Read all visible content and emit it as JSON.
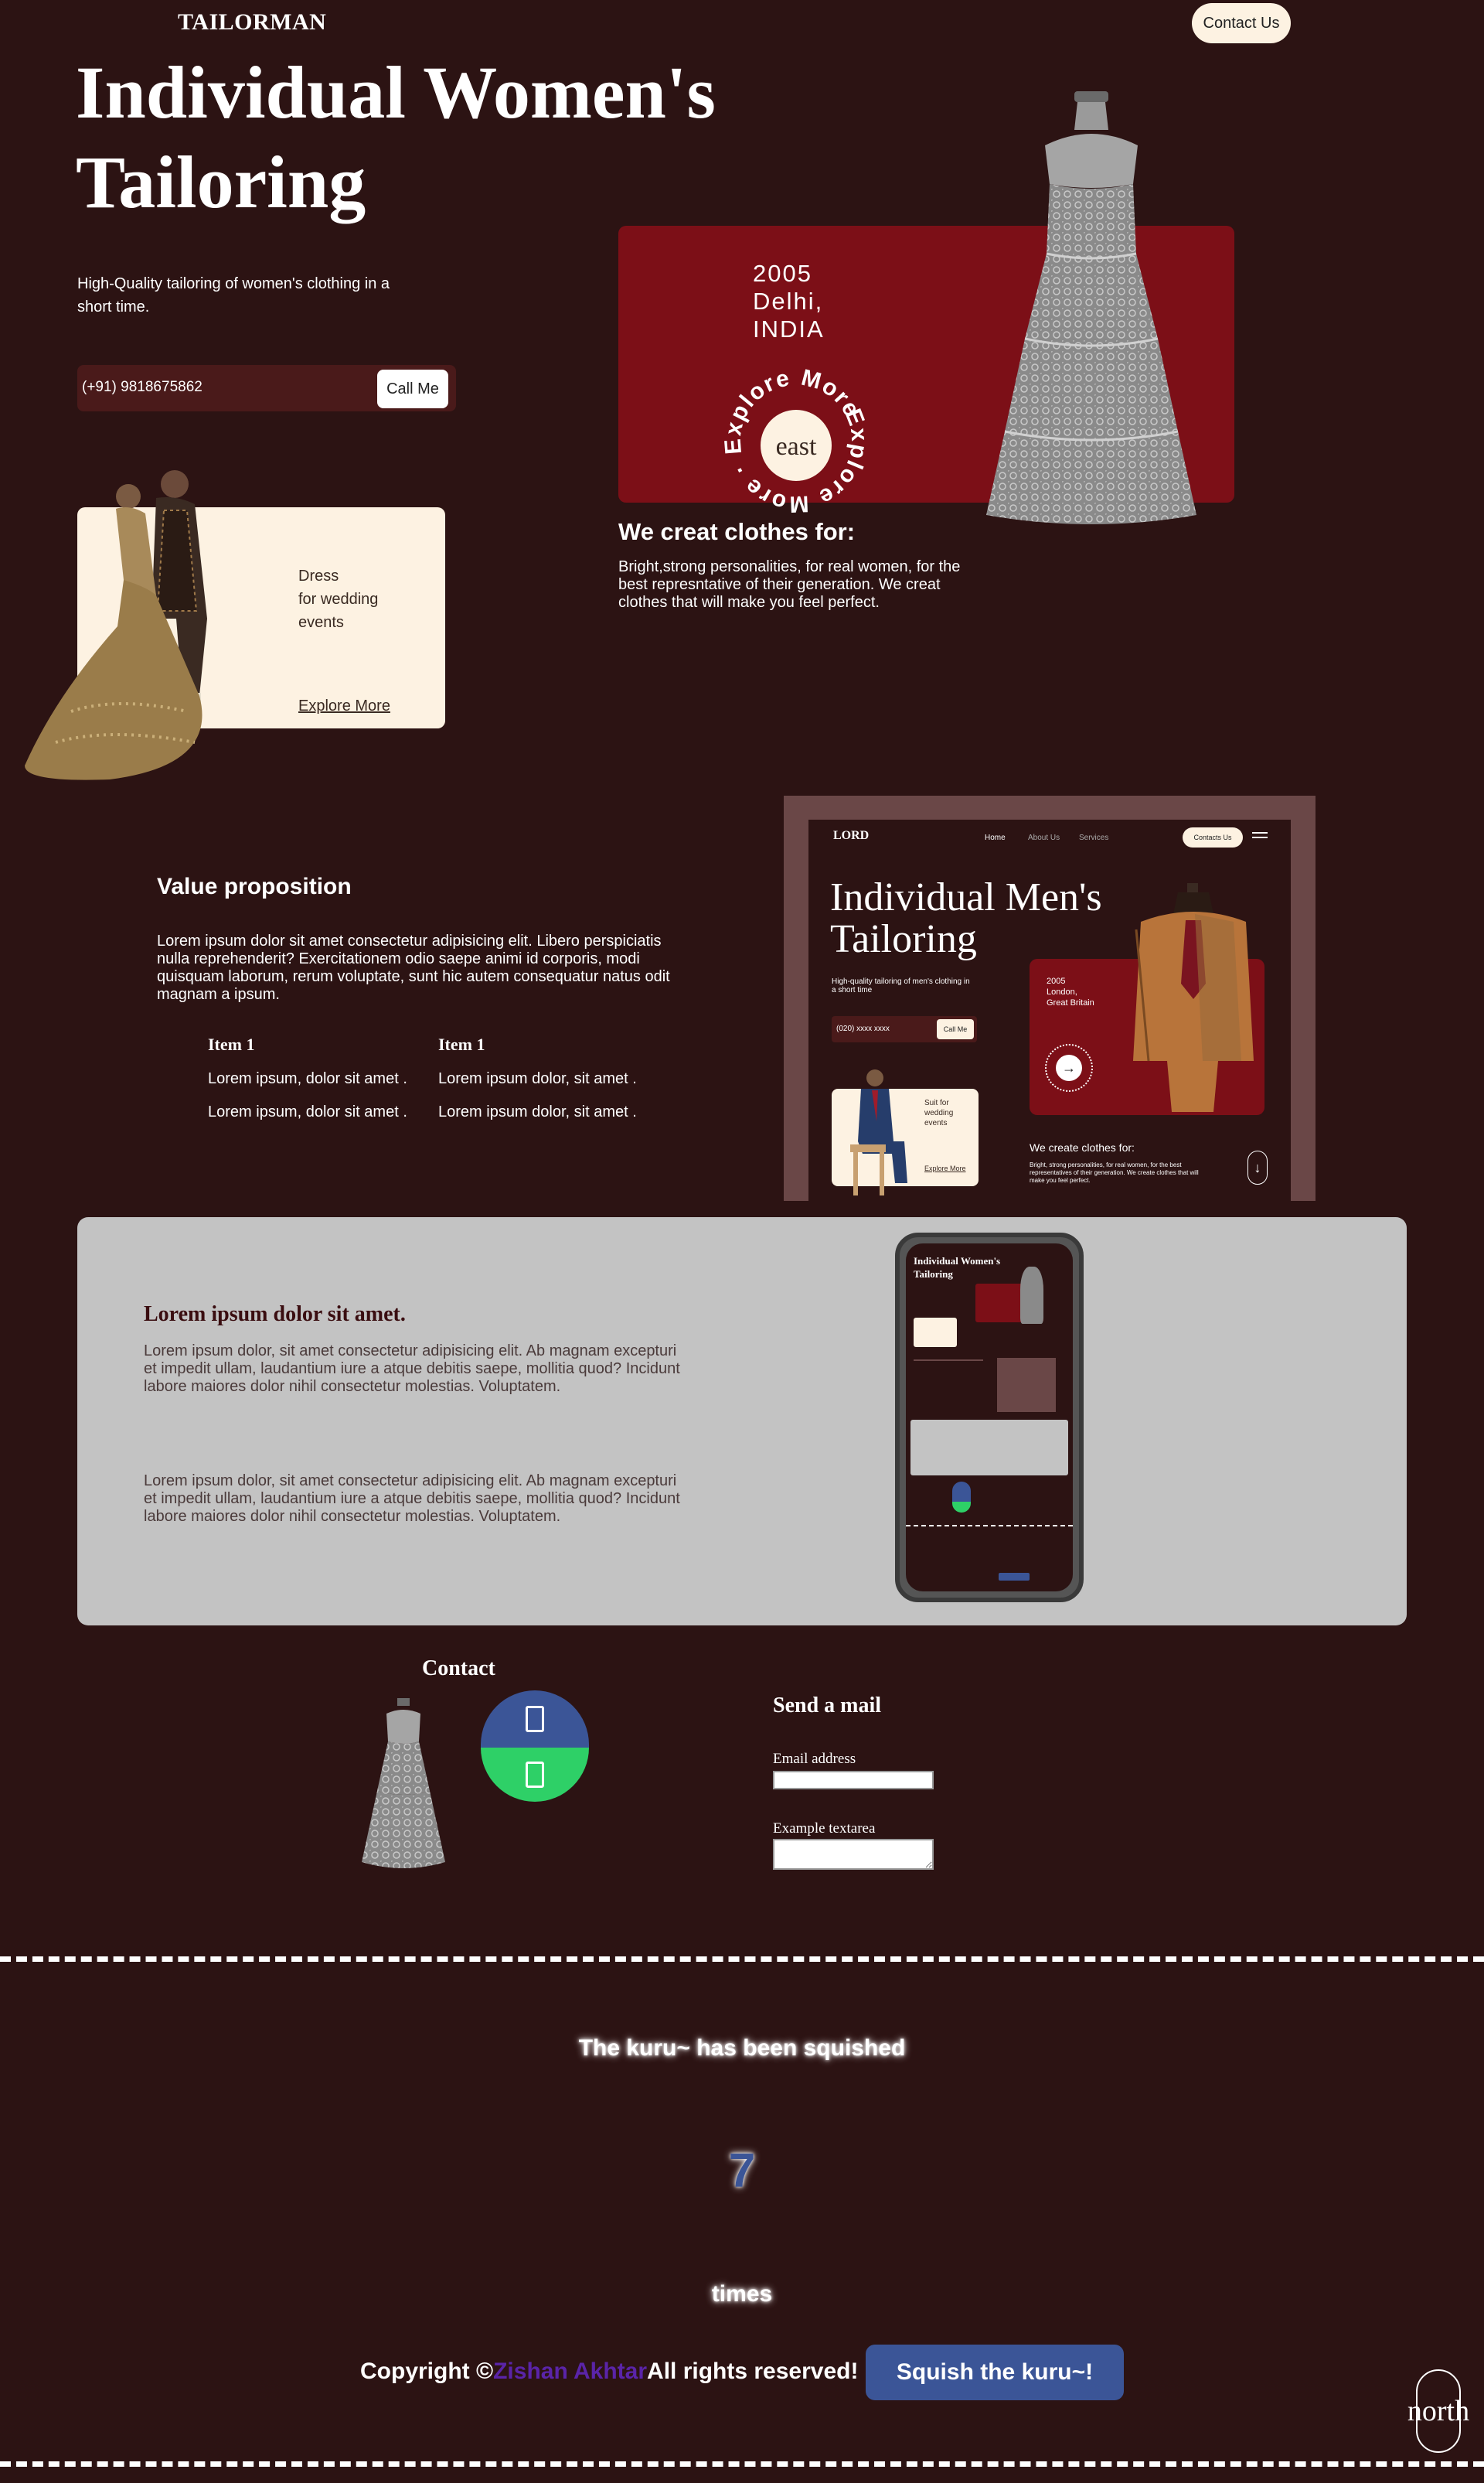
{
  "header": {
    "brand": "TAILORMAN",
    "contact_button": "Contact Us"
  },
  "hero": {
    "title": "Individual Women's Tailoring",
    "subtitle": "High-Quality tailoring of women's clothing in a short time.",
    "phone": "(+91) 9818675862",
    "call_button": "Call Me"
  },
  "since_card": {
    "year": "2005",
    "city": "Delhi,",
    "country": "INDIA",
    "badge_ring": "Explore More · Explore More ·",
    "badge_center": "east"
  },
  "we_create": {
    "title": "We creat clothes for:",
    "text": "Bright,strong personalities, for real women, for the best represntative of their generation. We creat clothes that will make you feel perfect."
  },
  "wedding_card": {
    "line1": "Dress",
    "line2": "for wedding",
    "line3": "events",
    "link": "Explore More"
  },
  "value_prop": {
    "title": "Value proposition",
    "text": "Lorem ipsum dolor sit amet consectetur adipisicing elit. Libero perspiciatis nulla reprehenderit? Exercitationem odio saepe animi id corporis, modi quisquam laborum, rerum voluptate, sunt hic autem consequatur natus odit magnam a ipsum.",
    "columns": [
      {
        "heading": "Item 1",
        "rows": [
          "Lorem ipsum, dolor sit amet .",
          "Lorem ipsum, dolor sit amet ."
        ]
      },
      {
        "heading": "Item 1",
        "rows": [
          "Lorem ipsum dolor, sit amet .",
          "Lorem ipsum dolor, sit amet ."
        ]
      }
    ]
  },
  "mock_site": {
    "logo": "LORD",
    "nav": [
      "Home",
      "About Us",
      "Services"
    ],
    "contact": "Contacts Us",
    "title_line1": "Individual Men's",
    "title_line2": "Tailoring",
    "subtitle": "High-quality tailoring of men's clothing in a short time",
    "phone": "(020) xxxx xxxx",
    "call": "Call Me",
    "year": "2005",
    "city": "London,",
    "country": "Great Britain",
    "card_text": "Suit for wedding events",
    "card_link": "Explore More",
    "create_title": "We create clothes for:",
    "create_text": "Bright, strong personalities, for real women, for the best representatives of their generation. We create clothes that will make you feel perfect."
  },
  "grey_section": {
    "title": "Lorem ipsum dolor sit amet.",
    "para1": "Lorem ipsum dolor, sit amet consectetur adipisicing elit. Ab magnam excepturi et impedit ullam, laudantium iure a atque debitis saepe, mollitia quod? Incidunt labore maiores dolor nihil consectetur molestias. Voluptatem.",
    "para2": "Lorem ipsum dolor, sit amet consectetur adipisicing elit. Ab magnam excepturi et impedit ullam, laudantium iure a atque debitis saepe, mollitia quod? Incidunt labore maiores dolor nihil consectetur molestias. Voluptatem.",
    "phone_title": "Individual Women's Tailoring"
  },
  "contact": {
    "title": "Contact",
    "mail_title": "Send a mail",
    "email_label": "Email address",
    "textarea_label": "Example textarea",
    "facebook_color": "#3b5597",
    "whatsapp_color": "#2ed067"
  },
  "footer": {
    "squished_text": "The kuru~ has been squished",
    "count": "7",
    "times": "times",
    "copyright_prefix": "Copyright ©",
    "owner": "Zishan Akhtar",
    "copyright_suffix": "All rights reserved!",
    "squish_button": "Squish the kuru~!",
    "north_label": "north"
  },
  "colors": {
    "background": "#2c1313",
    "accent_red": "#7c0f17",
    "cream": "#fdf2e2",
    "button_blue": "#3b5597",
    "grey": "#c3c3c3"
  }
}
